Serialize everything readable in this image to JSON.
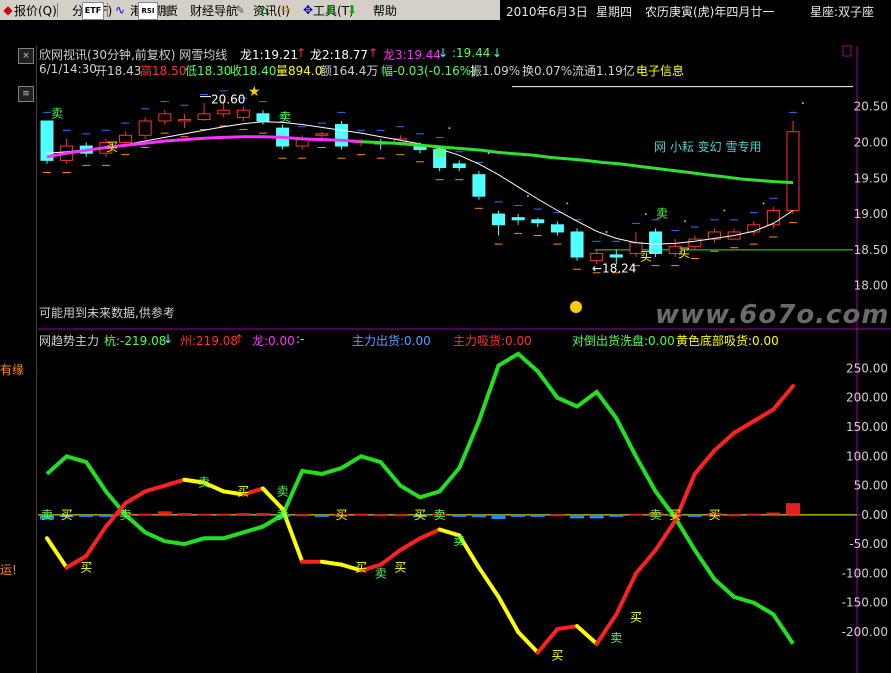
{
  "menubar": {
    "items": [
      {
        "label": "报价(Q)"
      },
      {
        "label": "分析(F)"
      },
      {
        "label": "港股期货"
      },
      {
        "label": "财经导航"
      },
      {
        "label": "资讯(I)"
      },
      {
        "label": "工具(T)"
      },
      {
        "label": "帮助"
      }
    ],
    "toolbar_icons": [
      "chart-icon",
      "etf-icon",
      "wave-icon",
      "rsi-icon",
      "grid-icon",
      "wrench-icon",
      "home-icon",
      "pencil-icon",
      "move-icon",
      "up-arrow-icon",
      "down-arrow-icon"
    ],
    "toolbar_labels": {
      "etf": "ETF",
      "rsi": "RSI"
    }
  },
  "datebar": {
    "date": "2010年6月3日",
    "weekday": "星期四",
    "lunar": "农历庚寅(虎)年四月廿一",
    "zodiac": "星座:双子座"
  },
  "leftstrip": {
    "text1": "有缘",
    "text2": "运!"
  },
  "colors": {
    "up": "#ff3030",
    "down": "#50ffff",
    "ma_white": "#ffffff",
    "ma_magenta": "#ff30ff",
    "ma_green": "#30e030",
    "axis_purple": "#a000a0",
    "label_yellow": "#ffff00",
    "label_cyan": "#50ffff",
    "watermark": "#606060"
  },
  "price_panel": {
    "title": "欣网视讯(30分钟,前复权) 网雪均线",
    "dragon1": "龙1:19.21",
    "dragon2": "龙2:18.77",
    "dragon3": "龙3:19.44",
    "extra": ":19.44",
    "ohlc_line": {
      "time": "6/1/14:30",
      "open": "开18.43",
      "high": "高18.50",
      "low": "低18.30",
      "close": "收18.40",
      "volume": "量894.0",
      "amount": "额164.4万",
      "change": "幅-0.03(-0.16%)",
      "amplitude": "振1.09%",
      "turnover": "换0.07%",
      "float": "流通1.19亿",
      "sector": "电子信息"
    },
    "high_label": "20.60",
    "low_label": "←18.24",
    "brand_note": "网 小耘 变幻 雪专用",
    "footer_note": "可能用到未来数据,供参考",
    "y_ticks": [
      "20.50",
      "20.00",
      "19.50",
      "19.00",
      "18.50",
      "18.00"
    ],
    "buy": "买",
    "sell": "卖"
  },
  "indicator_panel": {
    "title": "网趋势主力",
    "kang": "杭:-219.08",
    "zhou": "州:219.08",
    "long": "龙:0.00",
    "colon": ":-",
    "main_out": "主力出货:0.00",
    "main_in": "主力吸货:0.00",
    "wash": "对倒出货洗盘:0.00",
    "bottom": "黄色底部吸货:0.00",
    "y_ticks": [
      "250.00",
      "200.00",
      "150.00",
      "100.00",
      "50.00",
      "0.00",
      "-50.00",
      "-100.00",
      "-150.00",
      "-200.00"
    ]
  },
  "watermark": "www.6o7o.com",
  "chart_data": {
    "type": "candlestick",
    "ylim": [
      17.8,
      20.9
    ],
    "candles": [
      [
        20.3,
        19.75,
        20.3,
        19.7
      ],
      [
        19.75,
        19.95,
        20.05,
        19.7
      ],
      [
        19.95,
        19.85,
        20.0,
        19.8
      ],
      [
        19.85,
        20.0,
        20.05,
        19.8
      ],
      [
        20.0,
        20.1,
        20.15,
        19.95
      ],
      [
        20.1,
        20.3,
        20.35,
        20.05
      ],
      [
        20.3,
        20.4,
        20.45,
        20.25
      ],
      [
        20.3,
        20.32,
        20.4,
        20.2
      ],
      [
        20.32,
        20.4,
        20.55,
        20.3
      ],
      [
        20.4,
        20.45,
        20.6,
        20.35
      ],
      [
        20.35,
        20.45,
        20.5,
        20.3
      ],
      [
        20.4,
        20.3,
        20.45,
        20.25
      ],
      [
        20.2,
        19.95,
        20.25,
        19.9
      ],
      [
        19.95,
        20.05,
        20.1,
        19.9
      ],
      [
        20.1,
        20.12,
        20.15,
        20.05
      ],
      [
        20.25,
        19.95,
        20.3,
        19.9
      ],
      [
        20.0,
        20.02,
        20.05,
        19.95
      ],
      [
        20.0,
        19.98,
        20.05,
        19.9
      ],
      [
        20.0,
        20.05,
        20.1,
        19.95
      ],
      [
        19.95,
        19.9,
        20.0,
        19.85
      ],
      [
        19.9,
        19.65,
        19.95,
        19.6
      ],
      [
        19.7,
        19.65,
        19.75,
        19.6
      ],
      [
        19.55,
        19.25,
        19.6,
        19.2
      ],
      [
        19.0,
        18.85,
        19.05,
        18.7
      ],
      [
        18.95,
        18.92,
        19.0,
        18.85
      ],
      [
        18.92,
        18.88,
        18.95,
        18.82
      ],
      [
        18.85,
        18.75,
        18.9,
        18.7
      ],
      [
        18.75,
        18.4,
        18.8,
        18.35
      ],
      [
        18.35,
        18.45,
        18.5,
        18.3
      ],
      [
        18.43,
        18.4,
        18.5,
        18.3
      ],
      [
        18.45,
        18.6,
        18.75,
        18.4
      ],
      [
        18.75,
        18.45,
        18.8,
        18.4
      ],
      [
        18.45,
        18.55,
        18.65,
        18.4
      ],
      [
        18.55,
        18.65,
        18.7,
        18.5
      ],
      [
        18.65,
        18.75,
        18.8,
        18.6
      ],
      [
        18.65,
        18.75,
        18.8,
        18.65
      ],
      [
        18.75,
        18.85,
        18.9,
        18.7
      ],
      [
        18.85,
        19.05,
        19.1,
        18.8
      ],
      [
        19.05,
        20.15,
        20.3,
        19.0
      ]
    ],
    "ma_white": [
      19.85,
      19.87,
      19.9,
      19.93,
      19.97,
      20.02,
      20.07,
      20.12,
      20.17,
      20.22,
      20.26,
      20.29,
      20.28,
      20.25,
      20.21,
      20.17,
      20.13,
      20.08,
      20.03,
      19.98,
      19.91,
      19.82,
      19.7,
      19.55,
      19.38,
      19.21,
      19.05,
      18.9,
      18.76,
      18.66,
      18.6,
      18.58,
      18.59,
      18.62,
      18.66,
      18.7,
      18.76,
      18.87,
      19.05
    ],
    "ma_magenta": [
      19.8,
      19.85,
      19.89,
      19.93,
      19.96,
      19.99,
      20.02,
      20.04,
      20.06,
      20.07,
      20.08,
      20.08,
      20.07,
      20.05,
      20.04,
      20.03,
      20.01
    ],
    "ma_green": [
      20.01,
      20.0,
      19.99,
      19.97,
      19.95,
      19.93,
      19.91,
      19.89,
      19.86,
      19.84,
      19.82,
      19.79,
      19.77,
      19.75,
      19.72,
      19.7,
      19.67,
      19.64,
      19.61,
      19.58,
      19.55,
      19.52,
      19.49,
      19.47,
      19.45,
      19.44
    ],
    "indicator": {
      "green": [
        70,
        100,
        90,
        40,
        0,
        -30,
        -45,
        -50,
        -40,
        -40,
        -30,
        -20,
        0,
        75,
        70,
        80,
        100,
        90,
        50,
        30,
        40,
        80,
        160,
        255,
        275,
        245,
        200,
        185,
        210,
        165,
        100,
        40,
        -5,
        -60,
        -110,
        -140,
        -150,
        -170,
        -220
      ],
      "redyellow": [
        -40,
        -90,
        -70,
        -20,
        20,
        40,
        50,
        60,
        55,
        40,
        35,
        45,
        10,
        -80,
        -80,
        -85,
        -95,
        -85,
        -60,
        -40,
        -25,
        -35,
        -90,
        -140,
        -200,
        -235,
        -195,
        -190,
        -220,
        -170,
        -100,
        -60,
        -10,
        70,
        110,
        140,
        160,
        180,
        220
      ],
      "bars": [
        -8,
        -4,
        -2,
        -2,
        3,
        2,
        6,
        3,
        2,
        2,
        3,
        3,
        -4,
        1,
        -2,
        1,
        2,
        1,
        1,
        -4,
        2,
        -3,
        -4,
        -7,
        -3,
        -3,
        1,
        -6,
        -6,
        -2,
        2,
        4,
        1,
        -2,
        3,
        1,
        2,
        4,
        20
      ]
    }
  }
}
